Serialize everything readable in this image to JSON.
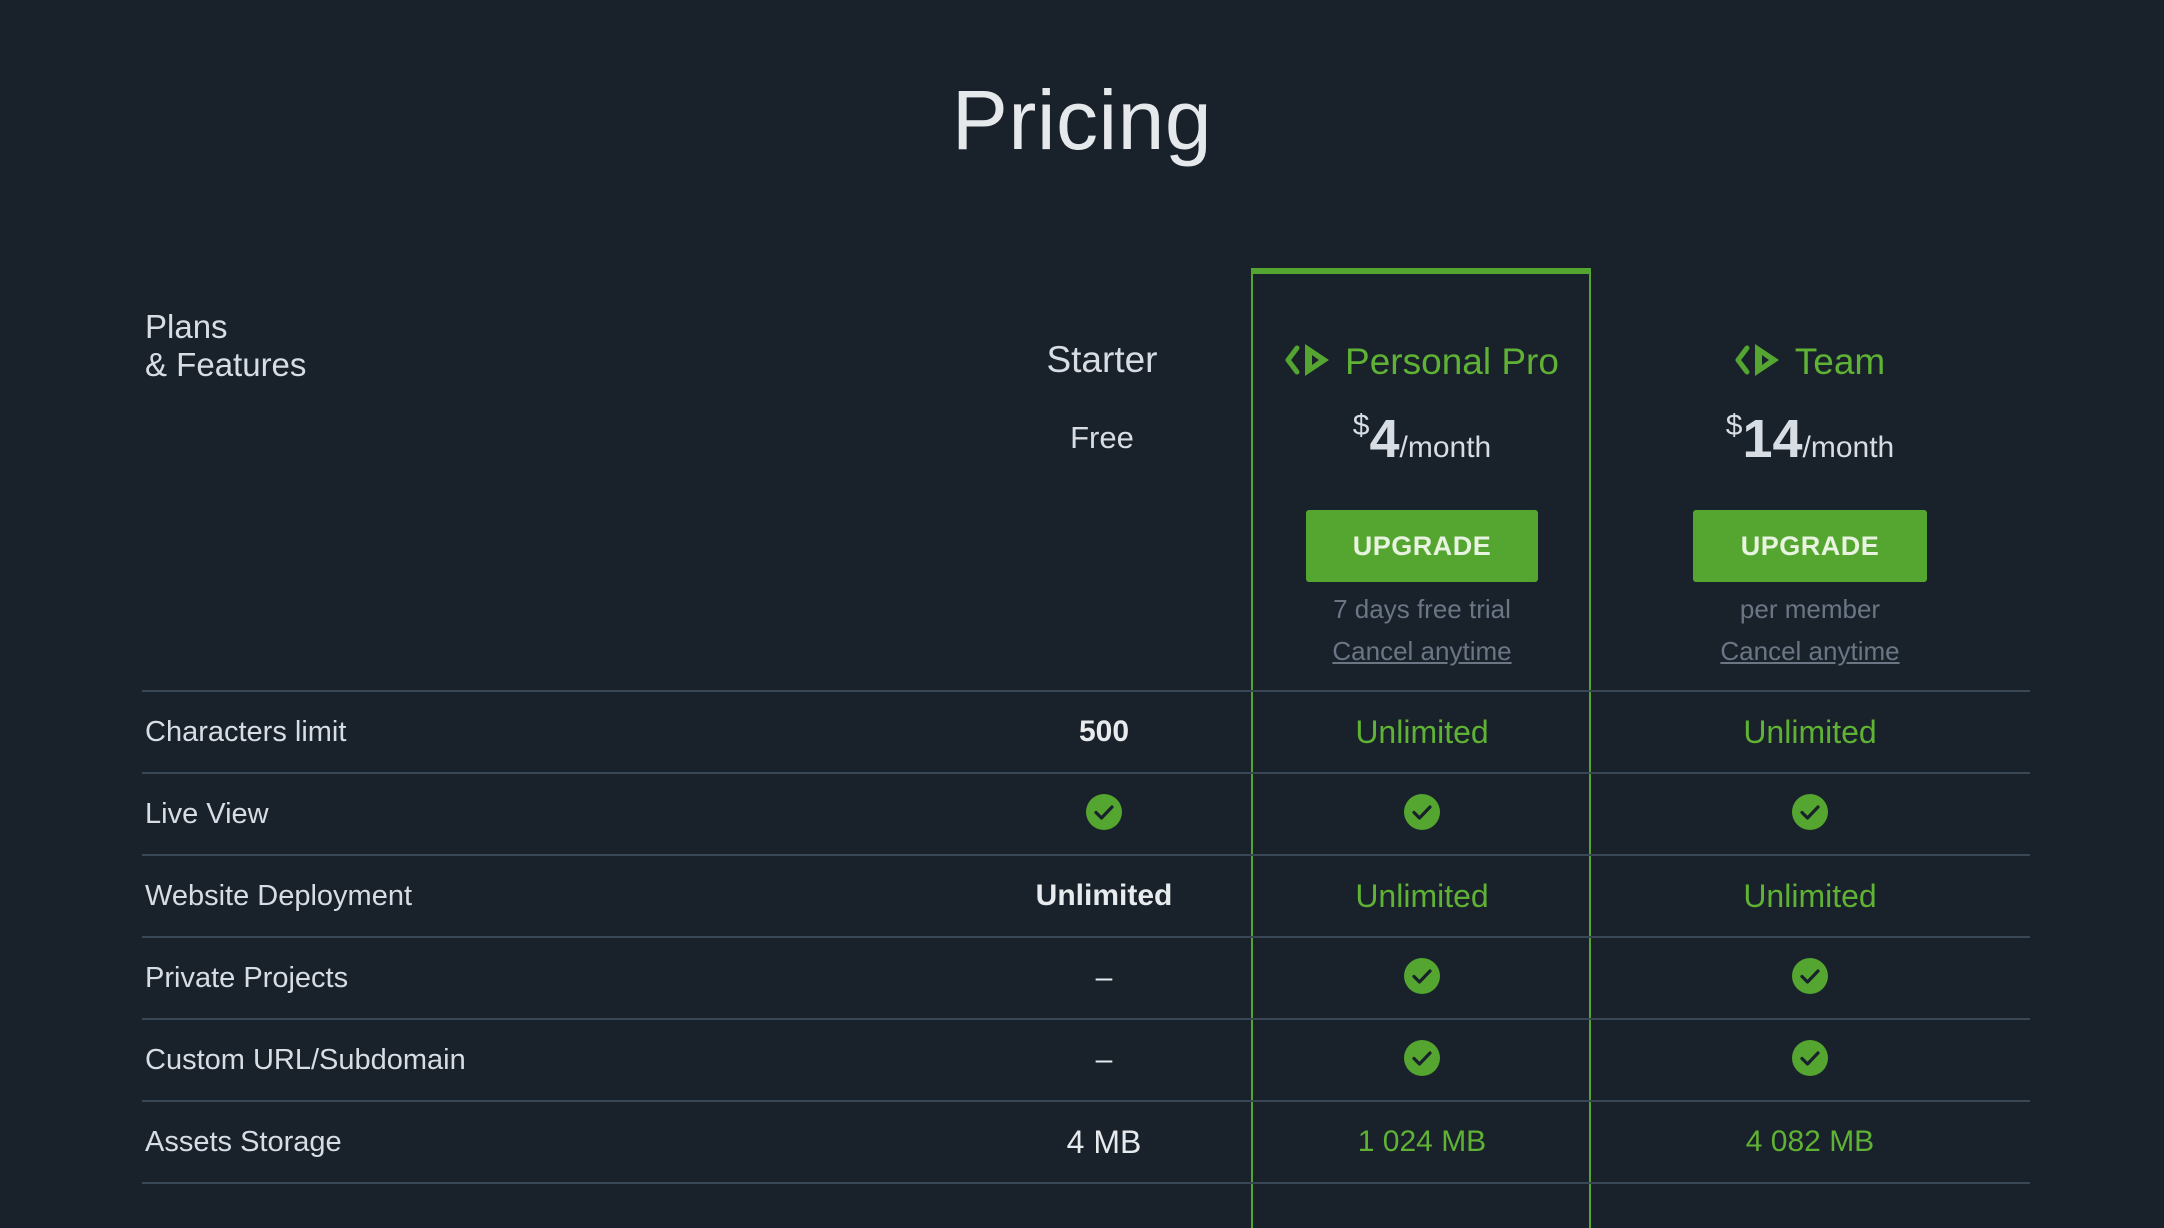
{
  "page": {
    "title": "Pricing"
  },
  "header": {
    "plans_label_line1": "Plans",
    "plans_label_line2": "& Features"
  },
  "plans": [
    {
      "name": "Starter",
      "price_text": "Free"
    },
    {
      "name": "Personal Pro",
      "currency": "$",
      "amount": "4",
      "period": "/month",
      "button": "UPGRADE",
      "note": "7 days free trial",
      "cancel": "Cancel anytime"
    },
    {
      "name": "Team",
      "currency": "$",
      "amount": "14",
      "period": "/month",
      "button": "UPGRADE",
      "note": "per member",
      "cancel": "Cancel anytime"
    }
  ],
  "features": [
    {
      "label": "Characters limit",
      "starter": "500",
      "pro": "Unlimited",
      "team": "Unlimited"
    },
    {
      "label": "Live View",
      "starter": "check",
      "pro": "check",
      "team": "check"
    },
    {
      "label": "Website Deployment",
      "starter": "Unlimited",
      "pro": "Unlimited",
      "team": "Unlimited"
    },
    {
      "label": "Private Projects",
      "starter": "–",
      "pro": "check",
      "team": "check"
    },
    {
      "label": "Custom URL/Subdomain",
      "starter": "–",
      "pro": "check",
      "team": "check"
    },
    {
      "label": "Assets Storage",
      "starter": "4 MB",
      "pro": "1 024 MB",
      "team": "4 082 MB"
    }
  ],
  "colors": {
    "background": "#19212b",
    "accent": "#55a630",
    "muted": "#6b7685",
    "divider": "#3a4755"
  },
  "icons": {
    "plan_logo": "code-play-icon",
    "feature_included": "check-circle-icon"
  }
}
